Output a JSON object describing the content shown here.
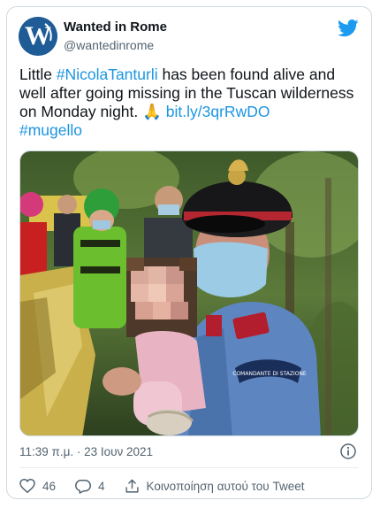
{
  "user": {
    "name": "Wanted in Rome",
    "handle": "@wantedinrome"
  },
  "tweet": {
    "text_plain_1": "Little ",
    "hashtag_1": "#NicolaTanturli",
    "text_plain_2": " has been found alive and well after going missing in the Tuscan wilderness on Monday night. ",
    "emoji": "🙏",
    "link": "bit.ly/3qrRwDO",
    "hashtag_2": "#mugello"
  },
  "photo": {
    "badge_text": "COMANDANTE DI STAZIONE"
  },
  "meta": {
    "timestamp": "11:39 π.μ. · 23 Ιουν 2021"
  },
  "actions": {
    "likes": "46",
    "replies": "4",
    "share_label": "Κοινοποίηση αυτού του Tweet"
  },
  "colors": {
    "link": "#1b95e0",
    "twitter_blue": "#1d9bf0",
    "like_red": "#e0245e"
  }
}
